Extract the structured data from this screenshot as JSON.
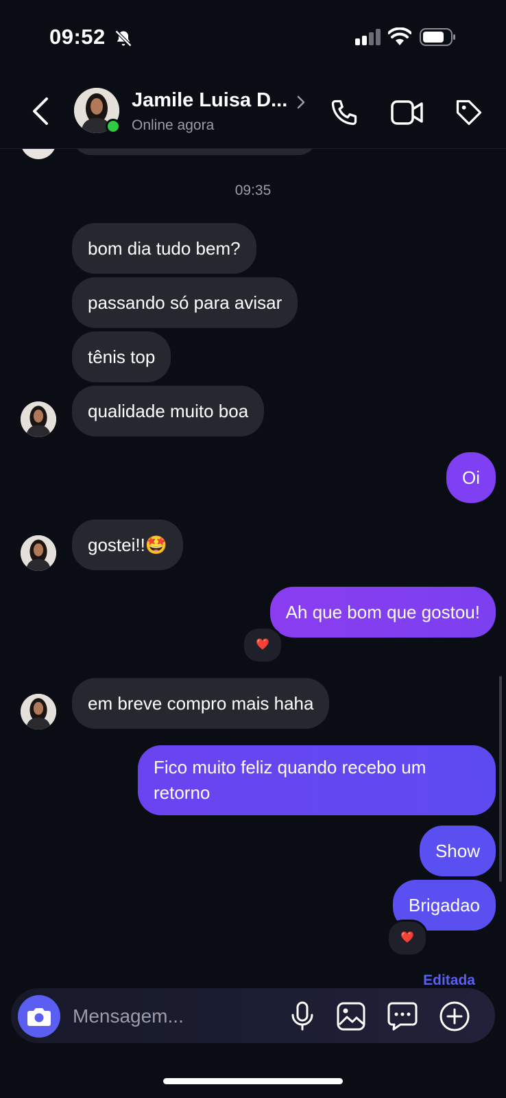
{
  "status_bar": {
    "time": "09:52",
    "icons": [
      "bell-slash-icon",
      "cellular-signal-icon",
      "wifi-icon",
      "battery-icon"
    ]
  },
  "header": {
    "contact_name": "Jamile Luisa D...",
    "status": "Online agora",
    "icons": [
      "back-chevron-icon",
      "chevron-right-icon",
      "phone-icon",
      "video-camera-icon",
      "tag-icon"
    ]
  },
  "conversation": {
    "timestamp": "09:35",
    "messages": [
      {
        "id": "m1",
        "from": "contact",
        "text": "bom dia tudo bem?"
      },
      {
        "id": "m2",
        "from": "contact",
        "text": "passando só para avisar"
      },
      {
        "id": "m3",
        "from": "contact",
        "text": "tênis top"
      },
      {
        "id": "m4",
        "from": "contact",
        "text": "qualidade muito boa"
      },
      {
        "id": "m5",
        "from": "me",
        "text": "Oi"
      },
      {
        "id": "m6",
        "from": "contact",
        "text": "gostei!!🤩"
      },
      {
        "id": "m7",
        "from": "me",
        "text": "Ah que bom que gostou!",
        "reaction": "❤️"
      },
      {
        "id": "m8",
        "from": "contact",
        "text": "em breve compro mais haha"
      },
      {
        "id": "m9",
        "from": "me",
        "text": "Fico muito feliz quando recebo um retorno"
      },
      {
        "id": "m10",
        "from": "me",
        "text": "Show"
      },
      {
        "id": "m11",
        "from": "me",
        "text": "Brigadao",
        "reaction": "❤️"
      }
    ],
    "edited_label": "Editada"
  },
  "composer": {
    "placeholder": "Mensagem...",
    "icons": [
      "camera-icon",
      "microphone-icon",
      "image-icon",
      "chat-bubble-icon",
      "plus-circle-icon"
    ]
  },
  "colors": {
    "background": "#0b0d15",
    "incoming_bubble": "#262830",
    "outgoing_gradient": [
      "#8a3df0",
      "#5a4ff0"
    ],
    "accent": "#5a5ff2",
    "online": "#2ecc40"
  }
}
